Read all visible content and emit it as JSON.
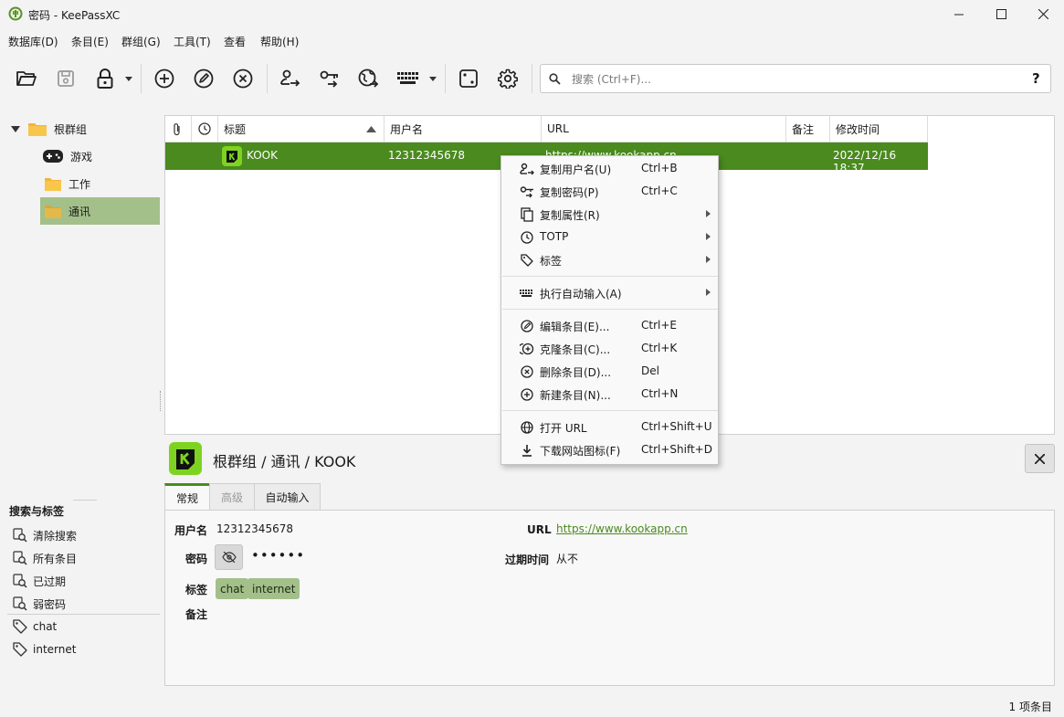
{
  "window": {
    "title": "密码 - KeePassXC",
    "controls": [
      "minimize-icon",
      "maximize-icon",
      "close-icon"
    ]
  },
  "menu": [
    "数据库(D)",
    "条目(E)",
    "群组(G)",
    "工具(T)",
    "查看",
    "帮助(H)"
  ],
  "toolbar": {
    "buttons": [
      "open-database-icon",
      "save-database-icon",
      "lock-database-icon",
      "add-entry-icon",
      "edit-entry-icon",
      "delete-entry-icon",
      "copy-username-icon",
      "copy-password-icon",
      "open-url-icon",
      "autotype-icon",
      "password-generator-icon",
      "settings-icon"
    ],
    "search_placeholder": "搜索 (Ctrl+F)...",
    "search_help": "?"
  },
  "tree": {
    "root": "根群组",
    "children": [
      "游戏",
      "工作",
      "通讯"
    ],
    "selected": "通讯"
  },
  "table": {
    "headers": [
      "标题",
      "用户名",
      "URL",
      "备注",
      "修改时间"
    ],
    "rows": [
      {
        "title": "KOOK",
        "username": "12312345678",
        "url": "https://www.kookapp.cn",
        "notes": "",
        "modified": "2022/12/16 18:37"
      }
    ]
  },
  "context_menu": {
    "groups": [
      [
        {
          "label": "复制用户名(U)",
          "shortcut": "Ctrl+B",
          "submenu": false,
          "icon": "copy-username-icon"
        },
        {
          "label": "复制密码(P)",
          "shortcut": "Ctrl+C",
          "submenu": false,
          "icon": "copy-password-icon"
        },
        {
          "label": "复制属性(R)",
          "shortcut": "",
          "submenu": true,
          "icon": "copy-icon"
        },
        {
          "label": "TOTP",
          "shortcut": "",
          "submenu": true,
          "icon": "clock-icon"
        },
        {
          "label": "标签",
          "shortcut": "",
          "submenu": true,
          "icon": "tag-icon"
        }
      ],
      [
        {
          "label": "执行自动输入(A)",
          "shortcut": "",
          "submenu": true,
          "icon": "keyboard-icon"
        }
      ],
      [
        {
          "label": "编辑条目(E)...",
          "shortcut": "Ctrl+E",
          "submenu": false,
          "icon": "edit-icon"
        },
        {
          "label": "克隆条目(C)...",
          "shortcut": "Ctrl+K",
          "submenu": false,
          "icon": "clone-icon"
        },
        {
          "label": "删除条目(D)...",
          "shortcut": "Del",
          "submenu": false,
          "icon": "delete-icon"
        },
        {
          "label": "新建条目(N)...",
          "shortcut": "Ctrl+N",
          "submenu": false,
          "icon": "add-icon"
        }
      ],
      [
        {
          "label": "打开 URL",
          "shortcut": "Ctrl+Shift+U",
          "submenu": false,
          "icon": "globe-icon"
        },
        {
          "label": "下载网站图标(F)",
          "shortcut": "Ctrl+Shift+D",
          "submenu": false,
          "icon": "download-icon"
        }
      ]
    ]
  },
  "detail": {
    "path": "根群组 / 通讯 / KOOK",
    "tabs": [
      "常规",
      "高级",
      "自动输入"
    ],
    "active_tab": "常规",
    "fields": {
      "username_label": "用户名",
      "username": "12312345678",
      "password_label": "密码",
      "password": "••••••",
      "tags_label": "标签",
      "tags": [
        "chat",
        "internet"
      ],
      "notes_label": "备注",
      "url_label": "URL",
      "url": "https://www.kookapp.cn",
      "expires_label": "过期时间",
      "expires": "从不"
    }
  },
  "search_tags": {
    "title": "搜索与标签",
    "items": [
      {
        "label": "清除搜索",
        "icon": "search-clear-icon"
      },
      {
        "label": "所有条目",
        "icon": "search-icon"
      },
      {
        "label": "已过期",
        "icon": "search-expired-icon"
      },
      {
        "label": "弱密码",
        "icon": "search-weak-icon"
      }
    ],
    "tags": [
      "chat",
      "internet"
    ]
  },
  "status": {
    "count": "1 项条目"
  },
  "colors": {
    "accent": "#4a8a1e",
    "tag_bg": "#a3c08a",
    "selected_group": "#a3c08a",
    "kook_green": "#7ed321"
  }
}
